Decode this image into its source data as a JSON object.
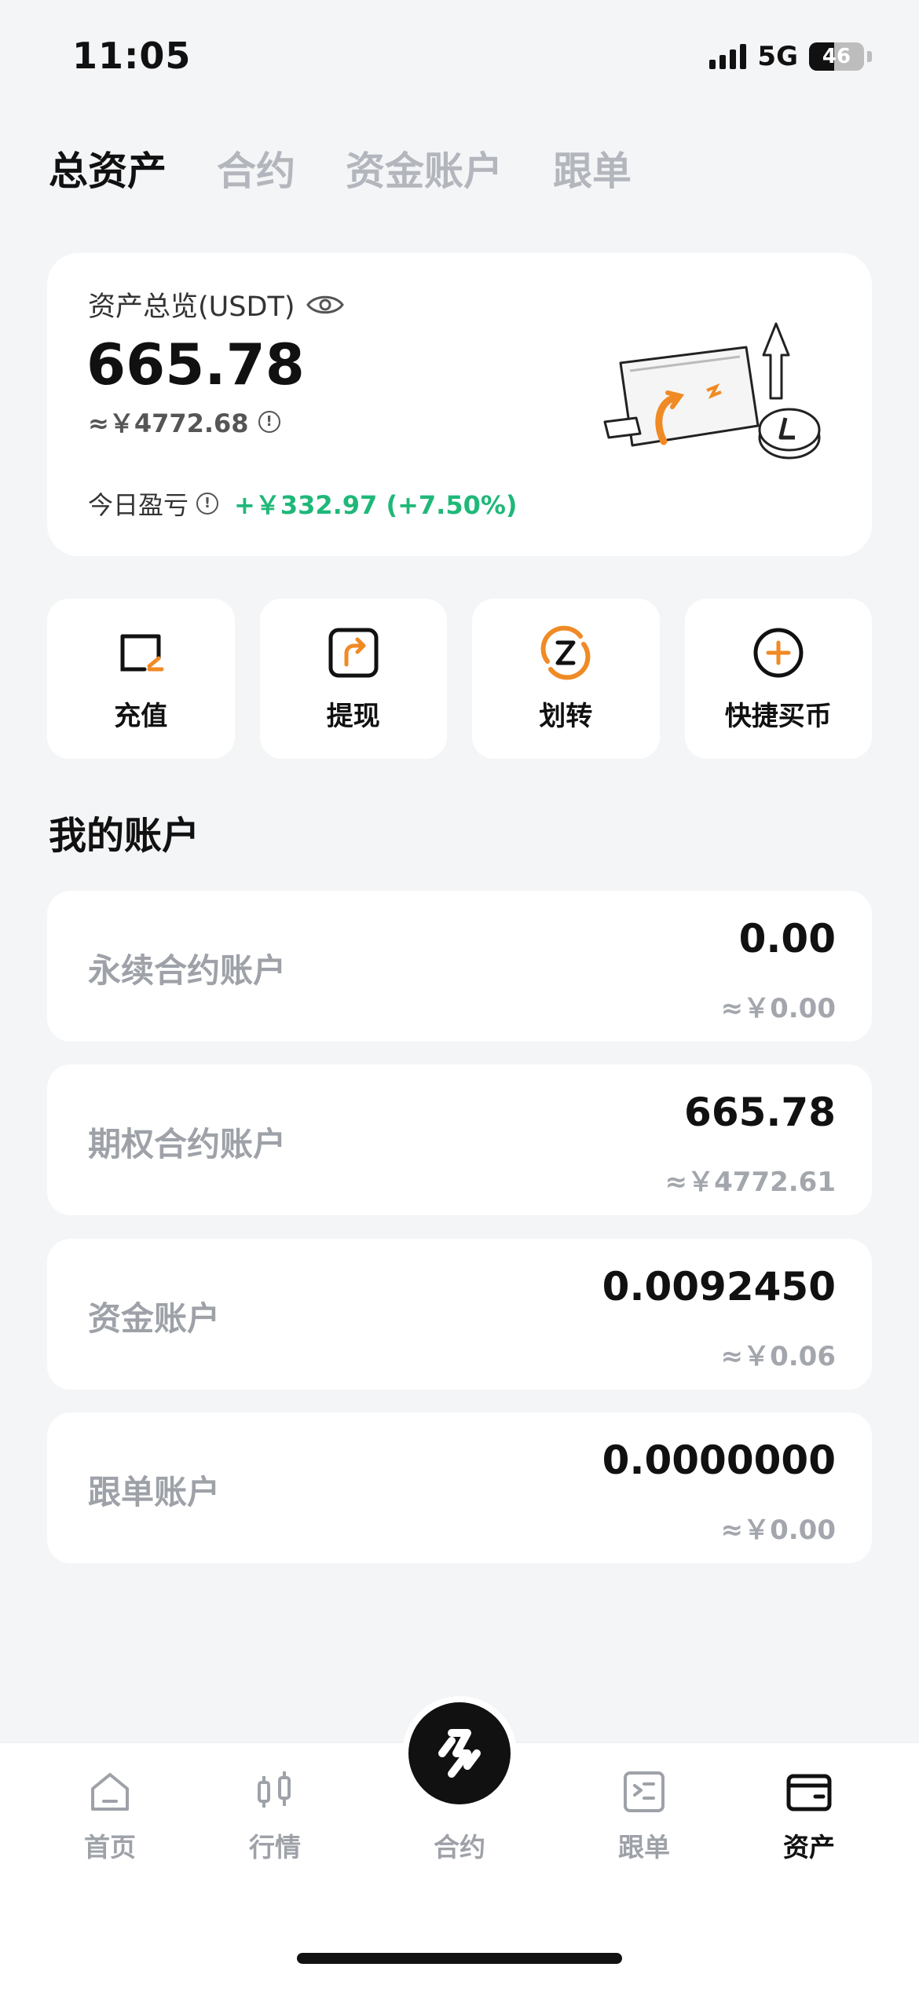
{
  "status_bar": {
    "time": "11:05",
    "network": "5G",
    "battery": "46",
    "battery_level": 0.46
  },
  "top_tabs": [
    {
      "label": "总资产",
      "active": true
    },
    {
      "label": "合约",
      "active": false
    },
    {
      "label": "资金账户",
      "active": false
    },
    {
      "label": "跟单",
      "active": false
    }
  ],
  "overview": {
    "label": "资产总览(USDT)",
    "total": "665.78",
    "cny": "≈￥4772.68",
    "pnl_label": "今日盈亏",
    "pnl_value": "+￥332.97 (+7.50%)"
  },
  "actions": [
    {
      "label": "充值",
      "icon": "deposit-icon"
    },
    {
      "label": "提现",
      "icon": "withdraw-icon"
    },
    {
      "label": "划转",
      "icon": "transfer-icon"
    },
    {
      "label": "快捷买币",
      "icon": "quick-buy-icon"
    }
  ],
  "accounts_title": "我的账户",
  "accounts": [
    {
      "name": "永续合约账户",
      "value": "0.00",
      "cny": "≈￥0.00"
    },
    {
      "name": "期权合约账户",
      "value": "665.78",
      "cny": "≈￥4772.61"
    },
    {
      "name": "资金账户",
      "value": "0.0092450",
      "cny": "≈￥0.06"
    },
    {
      "name": "跟单账户",
      "value": "0.0000000",
      "cny": "≈￥0.00"
    }
  ],
  "bottom_nav": [
    {
      "label": "首页",
      "icon": "home-icon",
      "active": false
    },
    {
      "label": "行情",
      "icon": "market-candles-icon",
      "active": false
    },
    {
      "label": "合约",
      "icon": "contract-logo-icon",
      "active": false
    },
    {
      "label": "跟单",
      "icon": "copy-trade-icon",
      "active": false
    },
    {
      "label": "资产",
      "icon": "wallet-icon",
      "active": true
    }
  ],
  "colors": {
    "accent": "#f08a24",
    "profit": "#1fb879",
    "background": "#f4f5f7"
  }
}
